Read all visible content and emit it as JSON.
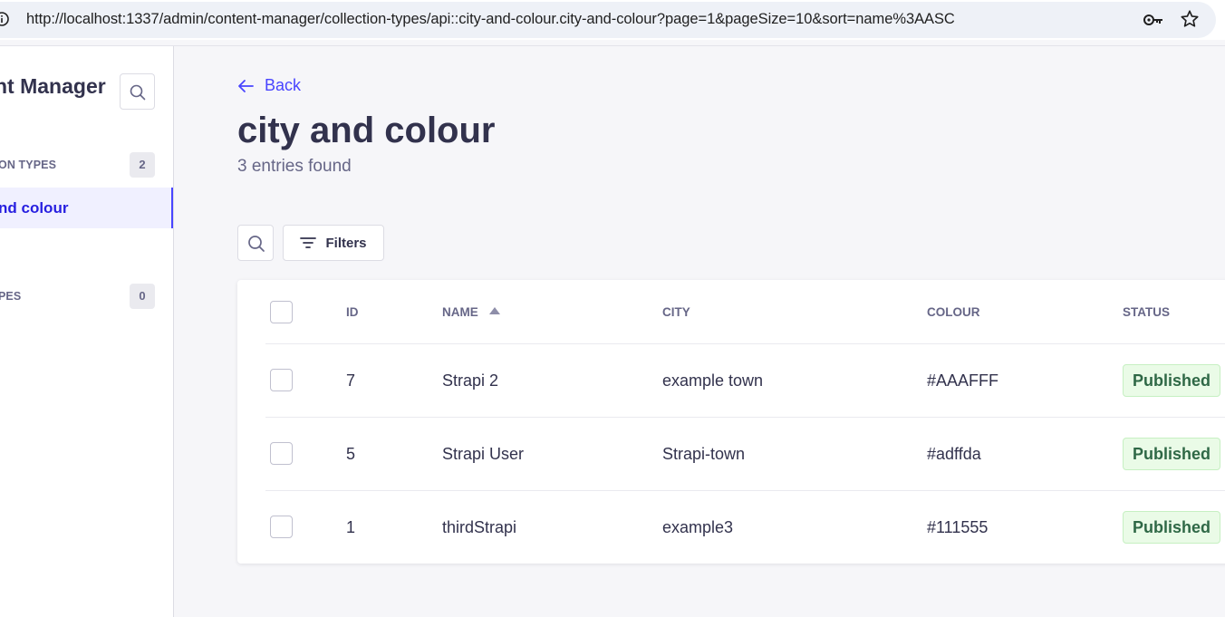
{
  "browser": {
    "url": "http://localhost:1337/admin/content-manager/collection-types/api::city-and-colour.city-and-colour?page=1&pageSize=10&sort=name%3AASC"
  },
  "sidebar": {
    "title": "nt Manager",
    "collection_types_label": "ON TYPES",
    "collection_types_count": "2",
    "active_item": "nd colour",
    "single_types_label": "PES",
    "single_types_count": "0"
  },
  "header": {
    "back_label": "Back",
    "title": "city and colour",
    "entries": "3 entries found"
  },
  "toolbar": {
    "filters_label": "Filters"
  },
  "table": {
    "columns": [
      "ID",
      "NAME",
      "CITY",
      "COLOUR",
      "STATUS"
    ],
    "rows": [
      {
        "id": "7",
        "name": "Strapi 2",
        "city": "example town",
        "colour": "#AAAFFF",
        "status": "Published"
      },
      {
        "id": "5",
        "name": "Strapi User",
        "city": "Strapi-town",
        "colour": "#adffda",
        "status": "Published"
      },
      {
        "id": "1",
        "name": "thirdStrapi",
        "city": "example3",
        "colour": "#111555",
        "status": "Published"
      }
    ]
  },
  "colors": {
    "accent": "#4945ff",
    "published_text": "#2f6846",
    "published_bg": "#eafbe7"
  }
}
